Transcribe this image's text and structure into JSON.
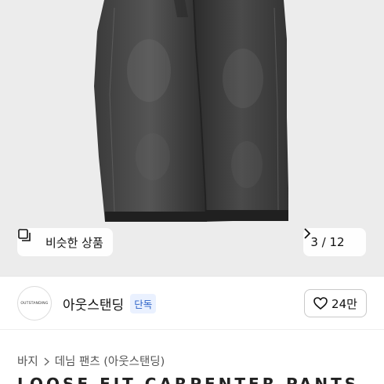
{
  "product_image": {
    "subject": "black denim jeans"
  },
  "similar_button": {
    "label": "비슷한 상품",
    "icon": "similar-items-icon"
  },
  "pager": {
    "current": 3,
    "total": 12,
    "label": "3 / 12",
    "icon": "chevron-right-icon"
  },
  "shop": {
    "logo_text": "OUTSTANDING",
    "name": "아웃스탠딩",
    "badge": "단독",
    "likes_label": "24만",
    "like_icon": "heart-outline-icon"
  },
  "breadcrumb": {
    "items": [
      "바지",
      "데님 팬츠 (아웃스탠딩)"
    ]
  },
  "product_title_partial": "LOOSE FIT CARPENTER PANTS BLACK",
  "colors": {
    "badge_text": "#2f64c8",
    "badge_bg": "#eaf1ff",
    "image_bg": "#ececec"
  }
}
